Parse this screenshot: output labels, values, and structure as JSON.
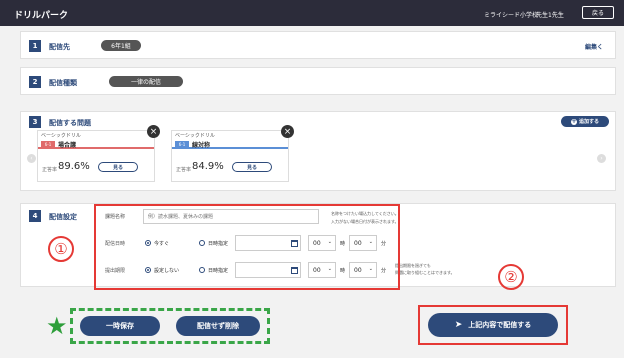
{
  "header": {
    "app_title": "ドリルパーク",
    "school": "ミライシード小学校",
    "teacher": "先生1先生",
    "back_label": "戻る"
  },
  "s1": {
    "num": "1",
    "title": "配信先",
    "grade": "6年1組",
    "edit": "編集く"
  },
  "s2": {
    "num": "2",
    "title": "配信種類",
    "type": "一律の配信"
  },
  "s3": {
    "num": "3",
    "title": "配信する問題",
    "add_label": "追加する",
    "cards": [
      {
        "subtitle": "ベーシックドリル",
        "tag": "6-1",
        "name": "場合譲",
        "rate_label": "正答率",
        "rate": "89.6%",
        "view": "見る",
        "tag_color": "#e06b6b"
      },
      {
        "subtitle": "ベーシックドリル",
        "tag": "6-1",
        "name": "線対称",
        "rate_label": "正答率",
        "rate": "84.9%",
        "view": "見る",
        "tag_color": "#5b8fd6"
      }
    ]
  },
  "s4": {
    "num": "4",
    "title": "配信設定",
    "task_label": "課題名称",
    "task_placeholder": "例）読水課題、夏休みの課題",
    "note1": "名称をつけたい場込力してください。",
    "note2": "入力がない場合日付が表示されます。",
    "deliver_label": "配信日時",
    "deliver_now": "今すぐ",
    "deliver_set": "日時指定",
    "deadline_label": "提出期限",
    "deadline_none": "設定しない",
    "deadline_set": "日時指定",
    "hour": "00",
    "minute": "00",
    "unit_hour": "時",
    "unit_min": "分",
    "note3": "提出期限を過ぎても",
    "note4": "問題に取り組むことはできます。"
  },
  "annotations": {
    "circle1": "①",
    "circle2": "②",
    "star": "★"
  },
  "actions": {
    "save_temp": "一時保存",
    "delete_without": "配信せず削除",
    "deliver": "上記内容で配信する"
  }
}
